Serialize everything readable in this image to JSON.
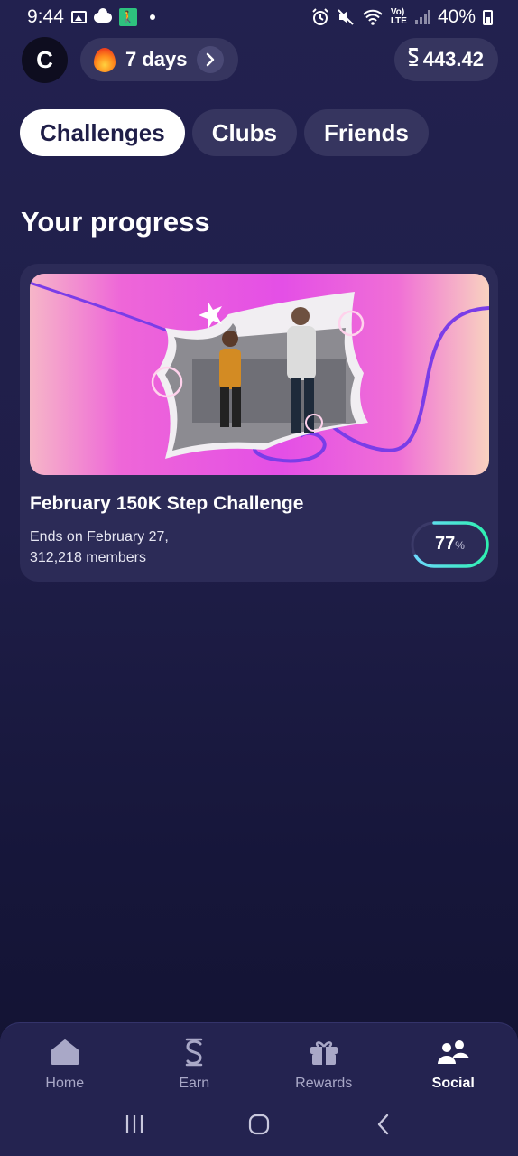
{
  "status_bar": {
    "time": "9:44",
    "battery": "40%",
    "icons": [
      "image-icon",
      "cloud-icon",
      "exit-icon",
      "dot-icon",
      "alarm-icon",
      "mute-icon",
      "wifi-icon",
      "volte-icon",
      "signal-icon",
      "battery-icon"
    ]
  },
  "header": {
    "avatar_initial": "C",
    "streak_label": "7 days",
    "balance": "443.42"
  },
  "tabs": [
    {
      "label": "Challenges",
      "active": true
    },
    {
      "label": "Clubs",
      "active": false
    },
    {
      "label": "Friends",
      "active": false
    }
  ],
  "section": {
    "title": "Your progress"
  },
  "challenge": {
    "title": "February 150K Step Challenge",
    "ends": "Ends on February 27,",
    "members": "312,218 members",
    "progress_value": "77",
    "progress_unit": "%",
    "progress_fraction": 0.77
  },
  "bottom_nav": [
    {
      "label": "Home",
      "icon": "home-icon",
      "active": false
    },
    {
      "label": "Earn",
      "icon": "sweatcoin-icon",
      "active": false
    },
    {
      "label": "Rewards",
      "icon": "gift-icon",
      "active": false
    },
    {
      "label": "Social",
      "icon": "people-icon",
      "active": true
    }
  ],
  "system_nav": [
    "recents-icon",
    "home-circle-icon",
    "back-icon"
  ],
  "colors": {
    "background": "#22214f",
    "chip": "#36355f",
    "progress_start": "#6fd8ff",
    "progress_end": "#2ef0b0"
  }
}
